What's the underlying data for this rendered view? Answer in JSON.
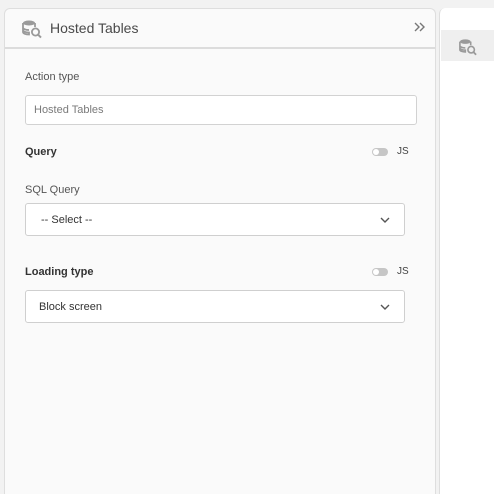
{
  "header": {
    "title": "Hosted Tables",
    "icon": "database-search-icon",
    "collapse_icon": "double-chevron-right-icon"
  },
  "action_type": {
    "label": "Action type",
    "value": "Hosted Tables"
  },
  "query_section": {
    "label": "Query",
    "js_label": "JS",
    "toggle_on": false
  },
  "sql_query": {
    "label": "SQL Query",
    "value": "-- Select --"
  },
  "loading_section": {
    "label": "Loading type",
    "js_label": "JS",
    "toggle_on": false
  },
  "loading_type": {
    "value": "Block screen"
  },
  "side_panel": {
    "icon": "database-search-icon"
  },
  "colors": {
    "icon": "#9a9a9a",
    "toggle_off": "#c6c6c6",
    "border": "#d2d2d2"
  }
}
